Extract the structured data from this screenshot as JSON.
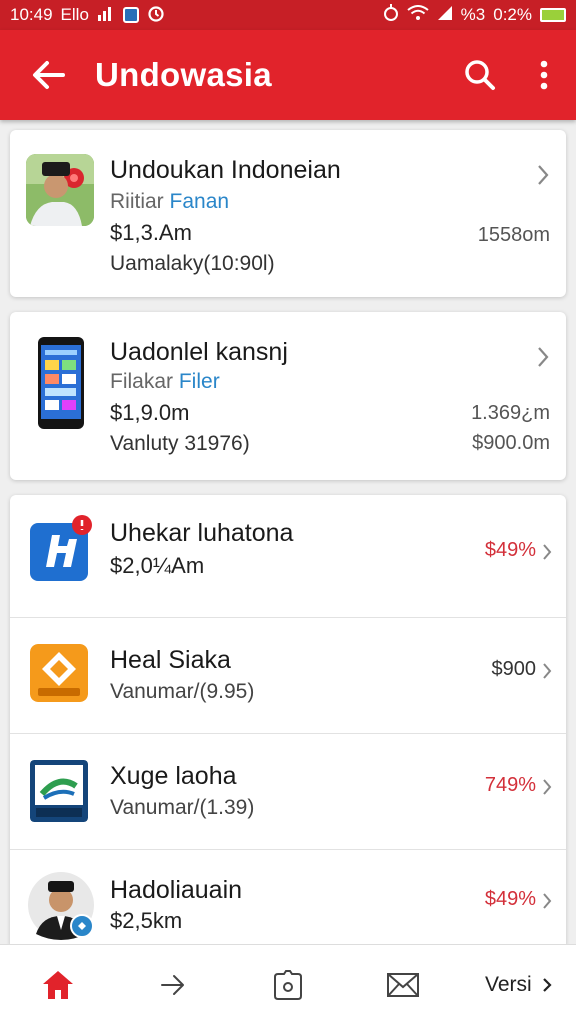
{
  "status_bar": {
    "time": "10:49",
    "left_text": "Ello",
    "right_text": "0:2%",
    "right_signal": "%3"
  },
  "app_bar": {
    "title": "Undowasia",
    "icons": [
      "back-arrow-icon",
      "search-icon",
      "more-vert-icon"
    ]
  },
  "cards": [
    {
      "title": "Undoukan  Indoneian",
      "sub_prefix": "Riitiar",
      "sub_accent": "Fanan",
      "price": "$1,3.Am",
      "meta": "Uamalaky(10:90l)",
      "right_value": "1558om",
      "right_value_2": ""
    },
    {
      "title": "Uadonlel kansnj",
      "sub_prefix": "Filakar",
      "sub_accent": "Filer",
      "price": "$1,9.0m",
      "meta": "Vanluty 31976)",
      "right_value": "1.369¿m",
      "right_value_2": "$900.0m"
    }
  ],
  "list_items": [
    {
      "title": "Uhekar luhatona",
      "sub": "$2,0¼Am",
      "value": "$49%",
      "value_color": "red"
    },
    {
      "title": "Heal Siaka",
      "sub": "Vanumar/(9.95)",
      "value": "$900",
      "value_color": "dark"
    },
    {
      "title": "Xuge laoha",
      "sub": "Vanumar/(1.39)",
      "value": "749%",
      "value_color": "red"
    },
    {
      "title": "Hadoliauain",
      "sub": "$2,5km",
      "value": "$49%",
      "value_color": "red"
    }
  ],
  "bottom_nav": {
    "items": [
      "home-icon",
      "forward-arrow-icon",
      "camera-icon",
      "mail-icon"
    ],
    "versi_label": "Versi",
    "active_color": "#e1232b"
  },
  "colors": {
    "brand": "#e1232b",
    "status_bar": "#c71f26",
    "accent_blue": "#2a86c9",
    "negative_red": "#d3303a"
  }
}
